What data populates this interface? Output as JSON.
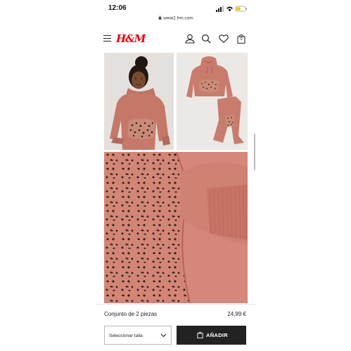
{
  "status_bar": {
    "time": "12:06"
  },
  "browser": {
    "url": "www2.hm.com"
  },
  "header": {
    "logo_text": "H&M",
    "cart_count": "0",
    "icons": [
      "menu-icon",
      "user-icon",
      "search-icon",
      "heart-icon",
      "bag-icon"
    ]
  },
  "product": {
    "name": "Conjunto de 2 piezas",
    "price": "24,99 €",
    "size_select_placeholder": "Seleccionar talla",
    "add_button_label": "AÑADIR"
  },
  "colors": {
    "brand_red": "#e50010",
    "button_dark": "#222222",
    "product_pink": "#d9837a"
  }
}
